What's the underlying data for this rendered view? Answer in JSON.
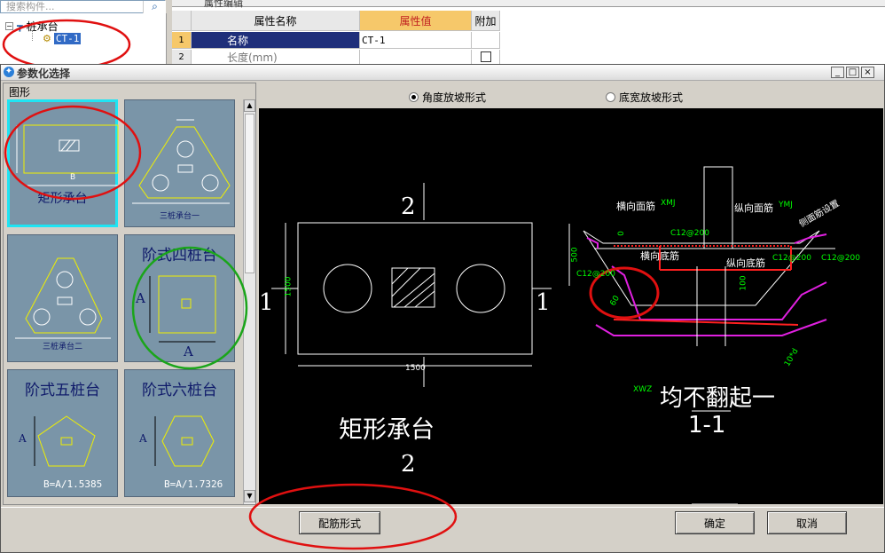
{
  "app": {
    "search_placeholder": "搜索构件...",
    "tree_root": "桩承台",
    "tree_child": "CT-1",
    "props_tab": "属性编辑",
    "props_headers": [
      "属性名称",
      "属性值",
      "附加"
    ],
    "props_rows": [
      {
        "idx": "1",
        "name": "名称",
        "value": "CT-1"
      },
      {
        "idx": "2",
        "name": "长度(mm)",
        "value": ""
      }
    ]
  },
  "dialog": {
    "title": "参数化选择",
    "group_label": "图形",
    "thumbnails": [
      {
        "label": "矩形承台",
        "dim": "B"
      },
      {
        "label": "三桩承台一",
        "dim": ""
      },
      {
        "label": "三桩承台二",
        "dim": ""
      },
      {
        "label": "阶式四桩台",
        "dim": "A"
      },
      {
        "label": "阶式五桩台",
        "dim": "B=A/1.5385"
      },
      {
        "label": "阶式六桩台",
        "dim": "B=A/1.7326"
      }
    ],
    "radio_angle": "角度放坡形式",
    "radio_width": "底宽放坡形式",
    "radio_selected": "angle",
    "drawing": {
      "plan_title": "矩形承台",
      "section_num_top": "2",
      "section_num_bottom": "2",
      "side_label_left": "1",
      "side_label_right": "1",
      "dim_width": "1500",
      "dim_height": "1500",
      "section_title": "均不翻起一",
      "section_name": "1-1",
      "rebar_top_x": "横向面筋",
      "rebar_top_x_code": "XMJ",
      "rebar_top_y": "纵向面筋",
      "rebar_top_y_code": "YMJ",
      "rebar_bottom_x": "横向底筋",
      "rebar_bottom_y": "纵向底筋",
      "spec1": "C12@200",
      "spec2": "C12@200",
      "spec3": "C12@200",
      "spec4": "C12@200",
      "side_rebar": "侧面筋设置",
      "dim_500": "500",
      "dim_0": "0",
      "dim_100": "100",
      "angle": "60",
      "xwz": "XWZ",
      "dim_10d": "10*d"
    },
    "buttons": {
      "rebar_form": "配筋形式",
      "ok": "确定",
      "cancel": "取消"
    }
  },
  "colors": {
    "accent_selected": "#1fe4f3",
    "annotation_red": "#e01010",
    "annotation_green": "#1aa51a",
    "cad_magenta": "#e020e0",
    "cad_red": "#ff2020",
    "cad_green": "#00ff00"
  }
}
